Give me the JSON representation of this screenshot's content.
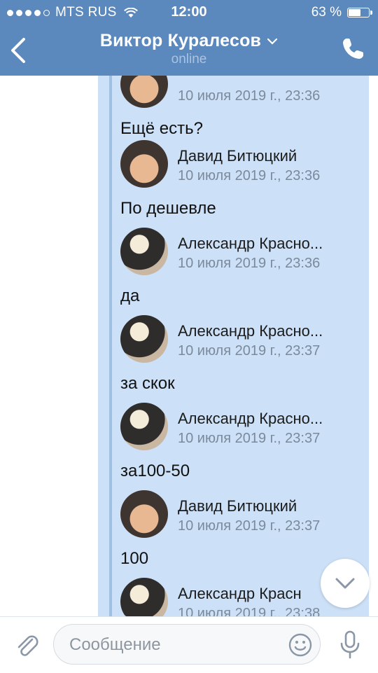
{
  "status": {
    "carrier": "MTS RUS",
    "time": "12:00",
    "battery": "63 %",
    "battery_level": 0.63
  },
  "header": {
    "title": "Виктор Куралесов",
    "subtitle": "online"
  },
  "messages": [
    {
      "author": "",
      "date": "10 июля 2019 г., 23:36",
      "text": "Ещё есть?",
      "avatar": "david"
    },
    {
      "author": "Давид Битюцкий",
      "date": "10 июля 2019 г., 23:36",
      "text": "По дешевле",
      "avatar": "david"
    },
    {
      "author": "Александр Красно...",
      "date": "10 июля 2019 г., 23:36",
      "text": "да",
      "avatar": "alex"
    },
    {
      "author": "Александр Красно...",
      "date": "10 июля 2019 г., 23:37",
      "text": "за скок",
      "avatar": "alex"
    },
    {
      "author": "Александр Красно...",
      "date": "10 июля 2019 г., 23:37",
      "text": "за100-50",
      "avatar": "alex"
    },
    {
      "author": "Давид Битюцкий",
      "date": "10 июля 2019 г., 23:37",
      "text": "100",
      "avatar": "david"
    },
    {
      "author": "Александр Красн",
      "date": "10 июля 2019 г., 23:38",
      "text": "",
      "avatar": "alex"
    }
  ],
  "input": {
    "placeholder": "Сообщение"
  },
  "icons": {
    "back": "chevron-left-icon",
    "call": "phone-icon",
    "title_dropdown": "chevron-down-icon",
    "scroll": "chevron-down-icon",
    "attach": "paperclip-icon",
    "emoji": "smiley-icon",
    "mic": "microphone-icon"
  },
  "colors": {
    "header": "#5b88bd",
    "bubble": "#cce0f7",
    "quote_line": "#9fbfe3"
  }
}
